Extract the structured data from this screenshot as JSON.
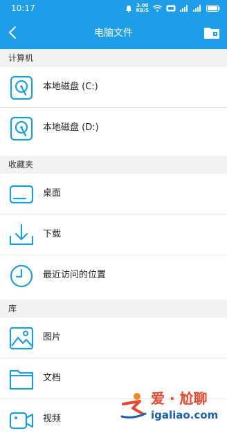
{
  "status_bar": {
    "time": "10:17",
    "net_speed": "3.00",
    "net_unit": "KB/S"
  },
  "header": {
    "title": "电脑文件"
  },
  "sections": {
    "computer": {
      "label": "计算机"
    },
    "favorites": {
      "label": "收藏夹"
    },
    "library": {
      "label": "库"
    }
  },
  "items": {
    "disk_c": "本地磁盘 (C:)",
    "disk_d": "本地磁盘 (D:)",
    "desktop": "桌面",
    "downloads": "下载",
    "recent": "最近访问的位置",
    "pictures": "图片",
    "documents": "文档",
    "videos": "视频"
  },
  "watermark": {
    "line1": "爱 · 尬聊",
    "line2": "igaliao.com"
  },
  "colors": {
    "accent": "#1e9ee8",
    "icon": "#1a9fd9"
  }
}
